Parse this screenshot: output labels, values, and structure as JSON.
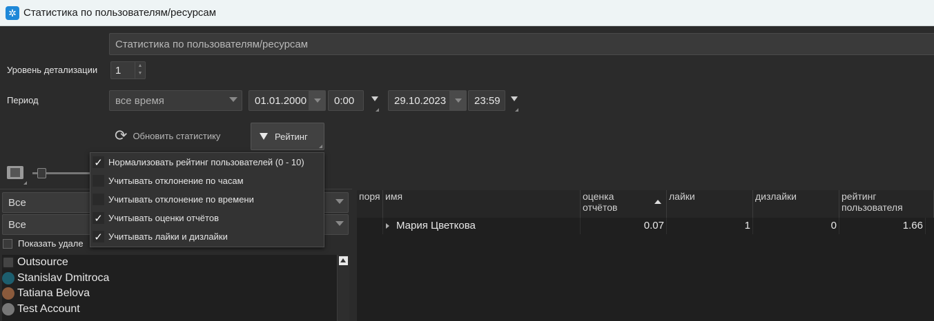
{
  "window": {
    "title": "Статистика по пользователям/ресурсам",
    "icon": "app-icon"
  },
  "form": {
    "title_field_value": "Статистика по пользователям/ресурсам",
    "detail_label": "Уровень детализации",
    "detail_value": "1",
    "period_label": "Период",
    "period_value": "все время",
    "date_from": "01.01.2000",
    "time_from": "0:00",
    "date_to": "29.10.2023",
    "time_to": "23:59",
    "refresh_label": "Обновить статистику",
    "rating_label": "Рейтинг"
  },
  "rating_menu": {
    "items": [
      {
        "label": "Нормализовать рейтинг пользователей (0 - 10)",
        "checked": true
      },
      {
        "label": "Учитывать отклонение по часам",
        "checked": false
      },
      {
        "label": "Учитывать отклонение по времени",
        "checked": false
      },
      {
        "label": "Учитывать оценки отчётов",
        "checked": true
      },
      {
        "label": "Учитывать лайки и дизлайки",
        "checked": true
      }
    ]
  },
  "filters": {
    "filter1_value": "Все",
    "filter2_value": "Все",
    "show_deleted_label": "Показать удале"
  },
  "user_list": {
    "items": [
      {
        "name": "Outsource",
        "icon": "group-icon"
      },
      {
        "name": "Stanislav Dmitroca",
        "icon": "avatar-icon"
      },
      {
        "name": "Tatiana Belova",
        "icon": "avatar-icon"
      },
      {
        "name": "Test Account",
        "icon": "user-icon"
      }
    ]
  },
  "table": {
    "headers": [
      "поря",
      "имя",
      "оценка\nотчётов",
      "лайки",
      "дизлайки",
      "рейтинг\nпользователя"
    ],
    "rows": [
      {
        "order": "",
        "name": "Мария Цветкова",
        "report_score": "0.07",
        "likes": "1",
        "dislikes": "0",
        "rating": "1.66"
      }
    ]
  }
}
